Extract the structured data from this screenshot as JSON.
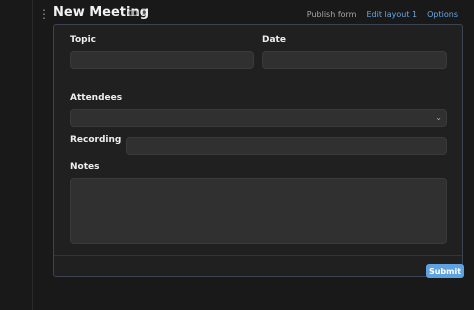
{
  "header": {
    "title": "New Meeting",
    "linked_count": "1",
    "actions": {
      "publish": "Publish form",
      "edit_layout": "Edit layout 1",
      "options": "Options"
    }
  },
  "form": {
    "fields": {
      "topic": {
        "label": "Topic",
        "value": ""
      },
      "date": {
        "label": "Date",
        "value": ""
      },
      "attendees": {
        "label": "Attendees",
        "value": ""
      },
      "recording": {
        "label": "Recording",
        "value": ""
      },
      "notes": {
        "label": "Notes",
        "value": ""
      }
    },
    "submit_label": "Submit"
  },
  "colors": {
    "accent": "#5fa2e0",
    "link": "#6aa6e4",
    "background": "#191919",
    "panel": "#202020",
    "field": "#303030"
  },
  "icons": {
    "drag": "dots-vertical-icon",
    "linked": "link-icon",
    "dropdown": "chevron-down-icon"
  }
}
